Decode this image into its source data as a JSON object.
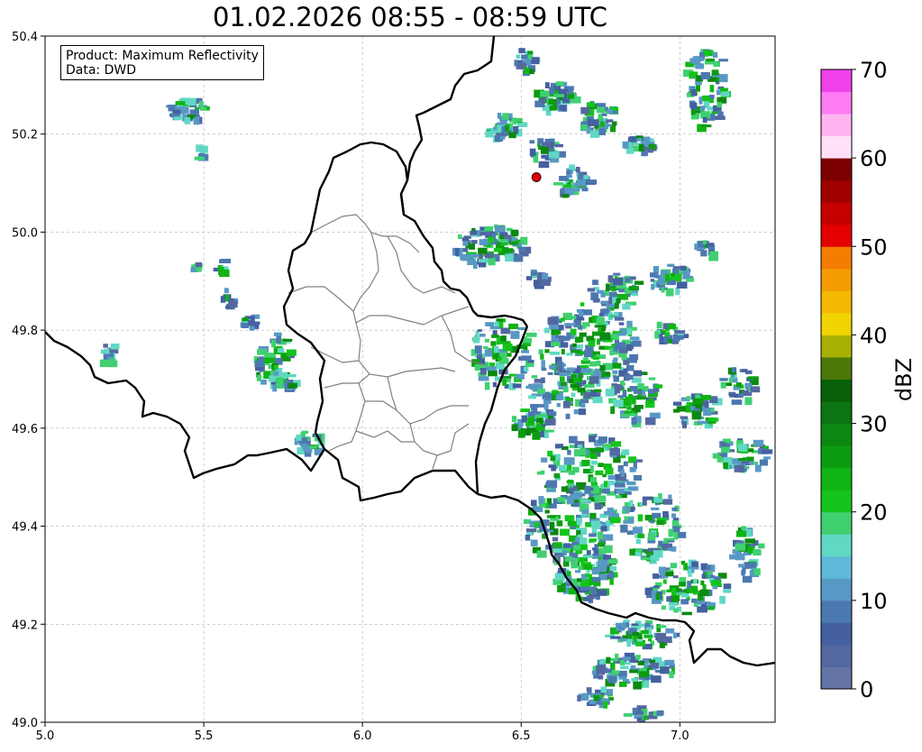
{
  "title": "01.02.2026 08:55 - 08:59 UTC",
  "info": {
    "product": "Product: Maximum Reflectivity",
    "data": "Data: DWD"
  },
  "map": {
    "lon_range": [
      5.0,
      7.3
    ],
    "lat_range": [
      49.0,
      50.4
    ],
    "x_ticks": [
      "5.0",
      "5.5",
      "6.0",
      "6.5",
      "7.0"
    ],
    "y_ticks": [
      "49.0",
      "49.2",
      "49.4",
      "49.6",
      "49.8",
      "50.0",
      "50.2",
      "50.4"
    ],
    "grid": true,
    "marker": {
      "lon": 6.548,
      "lat": 50.112,
      "color": "#e00000"
    }
  },
  "colorbar": {
    "label": "dBZ",
    "ticks": [
      "0",
      "10",
      "20",
      "30",
      "40",
      "50",
      "60",
      "70"
    ],
    "range": [
      0,
      70
    ],
    "step": 2.5,
    "colors": [
      "#6474a4",
      "#5468a0",
      "#4460a0",
      "#4c78b0",
      "#5898c4",
      "#60b8d8",
      "#60d8c4",
      "#40d070",
      "#14c41c",
      "#10b414",
      "#0c9c10",
      "#0c8810",
      "#0c7410",
      "#086008",
      "#4c7808",
      "#a8b004",
      "#f0d400",
      "#f4b800",
      "#f49c00",
      "#f47c00",
      "#e40000",
      "#c40000",
      "#a00000",
      "#7c0000",
      "#ffe0f8",
      "#ffb4f0",
      "#ff7cf4",
      "#f040ec"
    ]
  }
}
